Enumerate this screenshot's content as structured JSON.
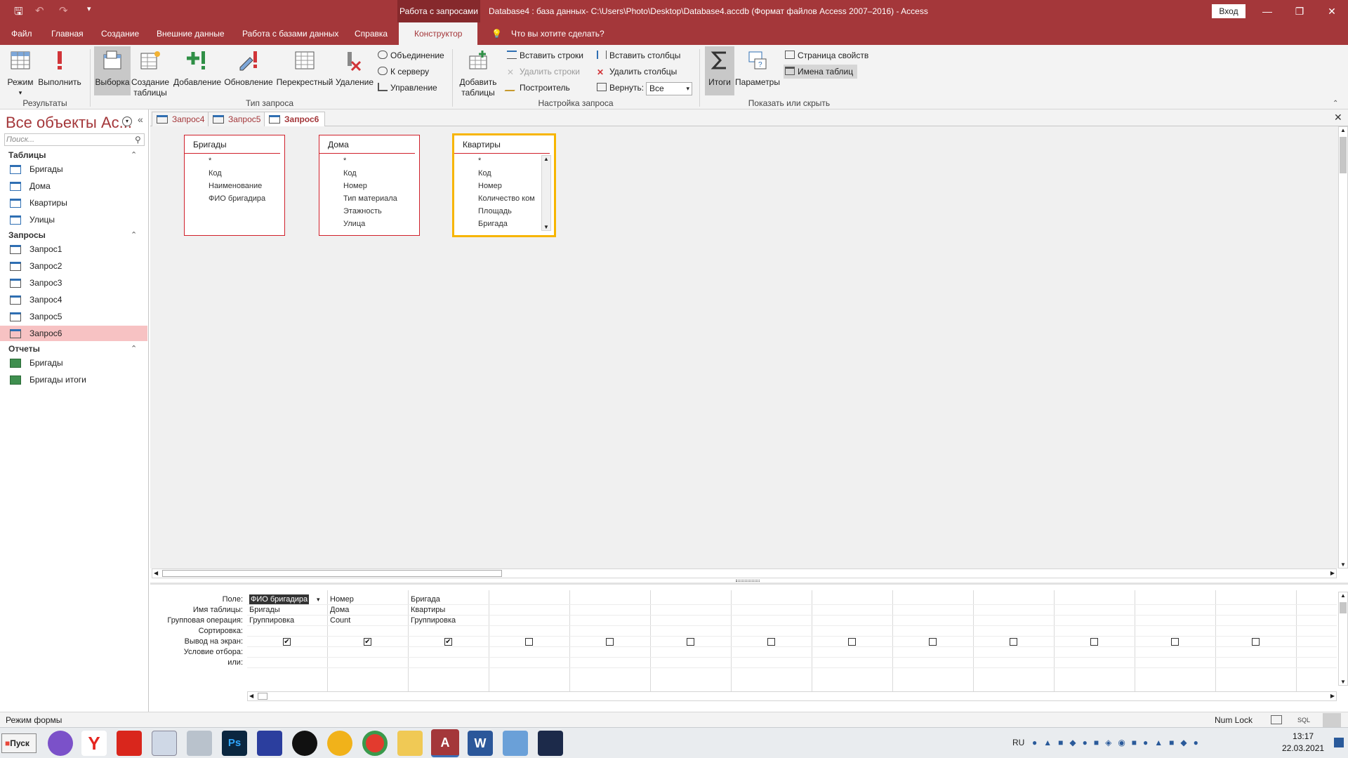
{
  "titlebar": {
    "context_tab": "Работа с запросами",
    "title": "Database4 : база данных- C:\\Users\\Photo\\Desktop\\Database4.accdb (Формат файлов Access 2007–2016)  -  Access",
    "sign_in": "Вход"
  },
  "tabs": [
    {
      "label": "Файл"
    },
    {
      "label": "Главная"
    },
    {
      "label": "Создание"
    },
    {
      "label": "Внешние данные"
    },
    {
      "label": "Работа с базами данных"
    },
    {
      "label": "Справка"
    },
    {
      "label": "Конструктор"
    },
    {
      "label": "Что вы хотите сделать?"
    }
  ],
  "ribbon": {
    "results": {
      "mode": "Режим",
      "run": "Выполнить",
      "group": "Результаты"
    },
    "query_type": {
      "select": "Выборка",
      "make_table_1": "Создание",
      "make_table_2": "таблицы",
      "append": "Добавление",
      "update": "Обновление",
      "crosstab": "Перекрестный",
      "delete": "Удаление",
      "union": "Объединение",
      "server": "К серверу",
      "ddl": "Управление",
      "group": "Тип запроса"
    },
    "setup": {
      "add_tables_1": "Добавить",
      "add_tables_2": "таблицы",
      "insert_rows": "Вставить строки",
      "delete_rows": "Удалить строки",
      "builder": "Построитель",
      "insert_cols": "Вставить столбцы",
      "delete_cols": "Удалить столбцы",
      "return_label": "Вернуть:",
      "return_value": "Все",
      "group": "Настройка запроса"
    },
    "show_hide": {
      "totals": "Итоги",
      "params": "Параметры",
      "property_sheet": "Страница свойств",
      "table_names": "Имена таблиц",
      "group": "Показать или скрыть"
    }
  },
  "nav": {
    "title": "Все объекты Ac...",
    "search_placeholder": "Поиск...",
    "sections": [
      {
        "header": "Таблицы",
        "items": [
          "Бригады",
          "Дома",
          "Квартиры",
          "Улицы"
        ]
      },
      {
        "header": "Запросы",
        "items": [
          "Запрос1",
          "Запрос2",
          "Запрос3",
          "Запрос4",
          "Запрос5",
          "Запрос6"
        ]
      },
      {
        "header": "Отчеты",
        "items": [
          "Бригады",
          "Бригады итоги"
        ]
      }
    ]
  },
  "doc_tabs": [
    "Запрос4",
    "Запрос5",
    "Запрос6"
  ],
  "tables": [
    {
      "name": "Бригады",
      "fields": [
        "*",
        "Код",
        "Наименование",
        "ФИО бригадира"
      ]
    },
    {
      "name": "Дома",
      "fields": [
        "*",
        "Код",
        "Номер",
        "Тип материала",
        "Этажность",
        "Улица"
      ]
    },
    {
      "name": "Квартиры",
      "fields": [
        "*",
        "Код",
        "Номер",
        "Количество ком",
        "Площадь",
        "Бригада"
      ]
    }
  ],
  "grid": {
    "row_labels": [
      "Поле:",
      "Имя таблицы:",
      "Групповая операция:",
      "Сортировка:",
      "Вывод на экран:",
      "Условие отбора:",
      "или:"
    ],
    "columns": [
      {
        "field": "ФИО бригадира",
        "table": "Бригады",
        "total": "Группировка",
        "show": true
      },
      {
        "field": "Номер",
        "table": "Дома",
        "total": "Count",
        "show": true
      },
      {
        "field": "Бригада",
        "table": "Квартиры",
        "total": "Группировка",
        "show": true
      },
      {
        "field": "",
        "table": "",
        "total": "",
        "show": false
      },
      {
        "field": "",
        "table": "",
        "total": "",
        "show": false
      },
      {
        "field": "",
        "table": "",
        "total": "",
        "show": false
      },
      {
        "field": "",
        "table": "",
        "total": "",
        "show": false
      },
      {
        "field": "",
        "table": "",
        "total": "",
        "show": false
      },
      {
        "field": "",
        "table": "",
        "total": "",
        "show": false
      },
      {
        "field": "",
        "table": "",
        "total": "",
        "show": false
      },
      {
        "field": "",
        "table": "",
        "total": "",
        "show": false
      },
      {
        "field": "",
        "table": "",
        "total": "",
        "show": false
      },
      {
        "field": "",
        "table": "",
        "total": "",
        "show": false
      }
    ]
  },
  "status": {
    "left": "Режим формы",
    "numlock": "Num Lock",
    "sql": "SQL"
  },
  "taskbar": {
    "start": "Пуск",
    "lang": "RU",
    "time": "13:17",
    "date": "22.03.2021"
  }
}
